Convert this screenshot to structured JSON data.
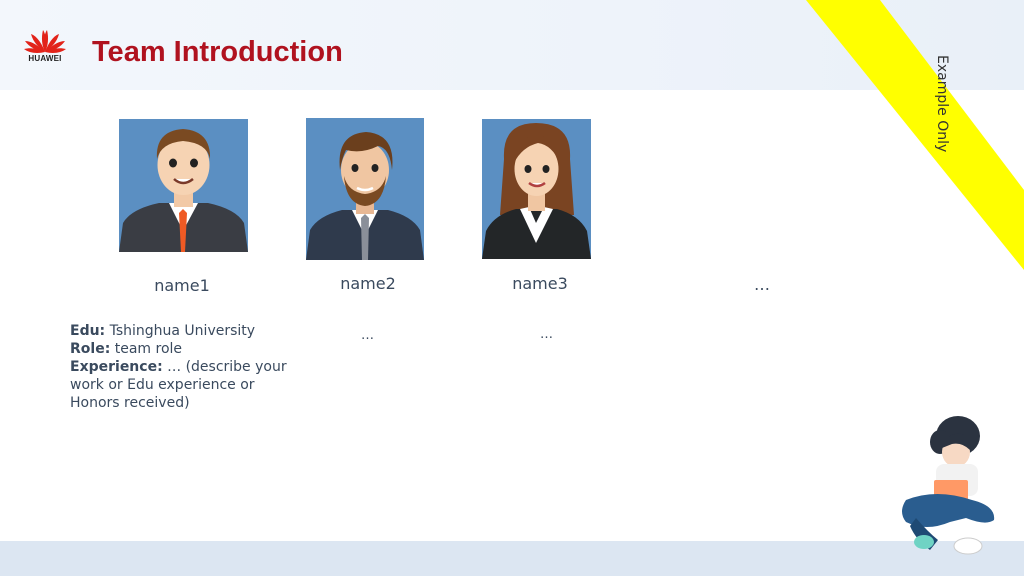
{
  "brand": {
    "name": "HUAWEI",
    "logo_color": "#e2231a"
  },
  "slide": {
    "title": "Team Introduction",
    "watermark": "Example Only",
    "title_color": "#b0121f",
    "ribbon_color": "#ffff00"
  },
  "team": {
    "members": [
      {
        "name": "name1",
        "avatar": "man-red-tie-avatar"
      },
      {
        "name": "name2",
        "avatar": "bearded-man-avatar"
      },
      {
        "name": "name3",
        "avatar": "woman-long-hair-avatar"
      }
    ],
    "more": "…",
    "member1_details": {
      "edu_label": "Edu:",
      "edu_value": "Tshinghua University",
      "role_label": "Role:",
      "role_value": "team role",
      "experience_label": "Experience:",
      "experience_value": "… (describe your work or Edu experience or Honors received)"
    },
    "member2_details": "…",
    "member3_details": "…"
  },
  "decor": {
    "mascot": "girl-with-laptop-mascot"
  }
}
